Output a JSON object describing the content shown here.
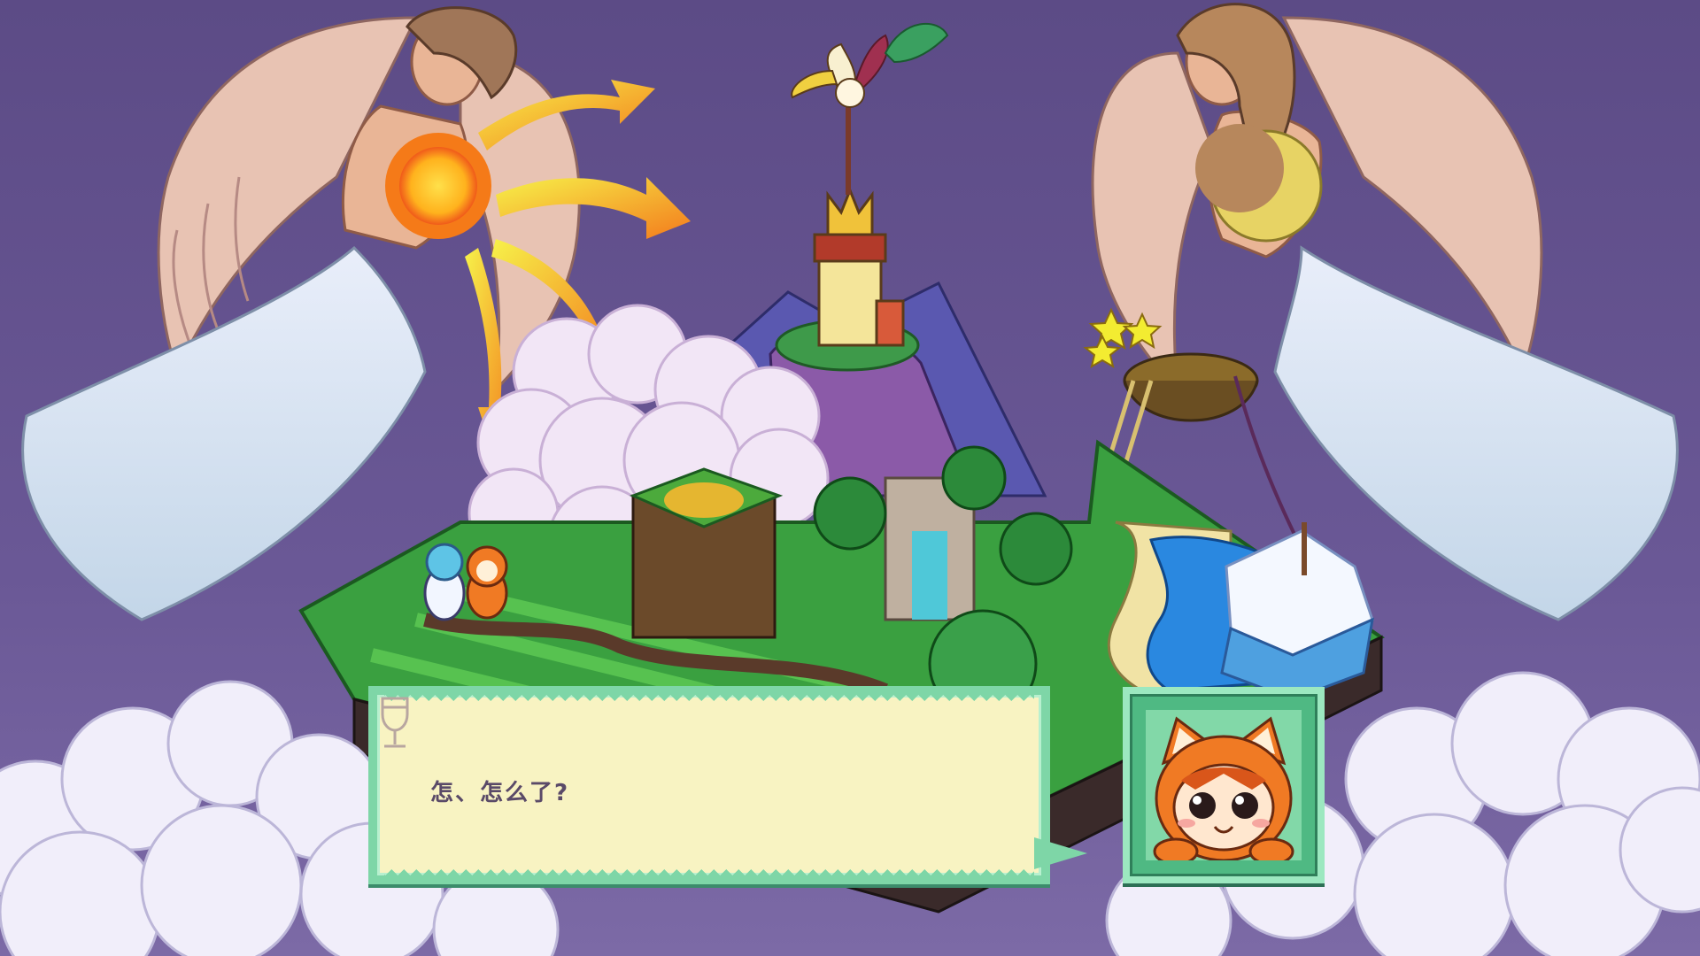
{
  "dialog": {
    "text": "怎、怎么了?",
    "continue_icon": "wine-glass-continue-icon"
  },
  "portrait": {
    "character": "orange-cat-hood-girl",
    "icon": "speaker-portrait-icon"
  },
  "colors": {
    "sky": "#5b4a86",
    "dialog_bg": "#f8f3c2",
    "dialog_border": "#7ed6a7",
    "text": "#5a4a68",
    "portrait_bg": "#82d8a8"
  }
}
